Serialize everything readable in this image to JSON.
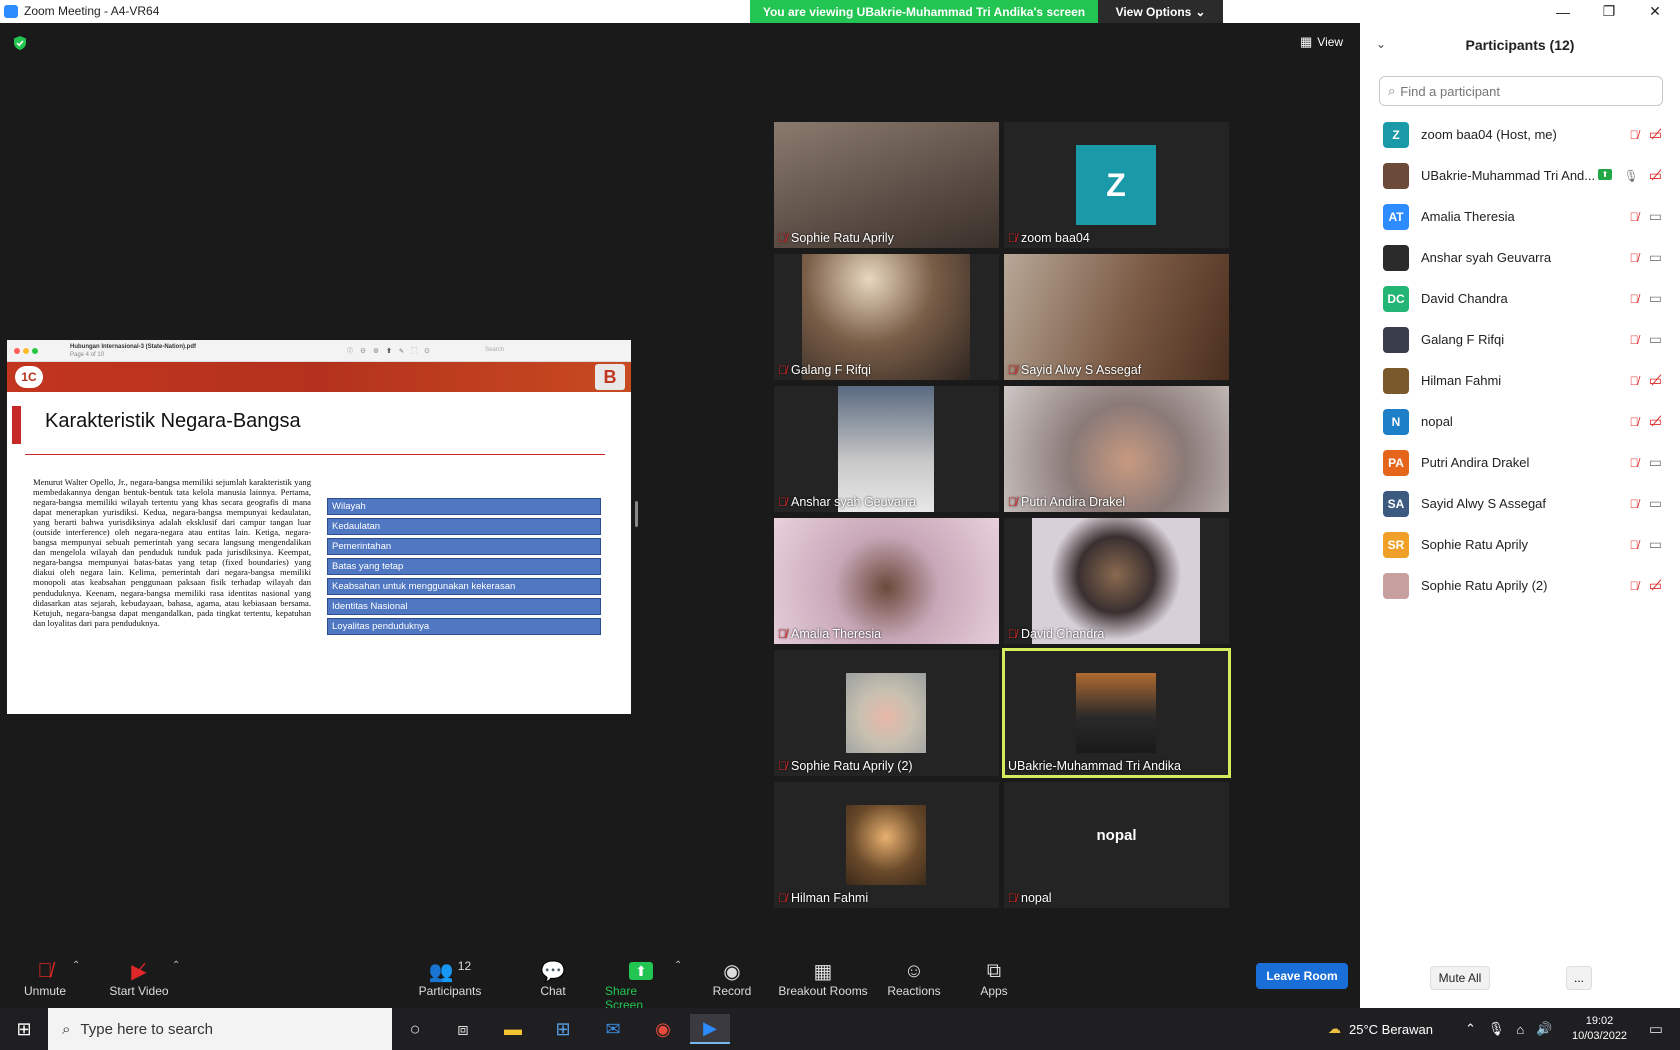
{
  "window": {
    "title": "Zoom Meeting - A4-VR64"
  },
  "banner": {
    "viewing_text": "You are viewing UBakrie-Muhammad Tri Andika's screen",
    "view_options": "View Options"
  },
  "view_button": {
    "label": "View"
  },
  "share": {
    "filename": "Hubungan Internasional-3 (State-Nation).pdf",
    "page_info": "Page 4 of 10",
    "search_placeholder": "Search",
    "slide_title": "Karakteristik Negara-Bangsa",
    "paragraph": "Menurut Walter Opello, Jr., negara-bangsa memiliki sejumlah karakteristik yang membedakannya dengan bentuk-bentuk tata kelola manusia lainnya. Pertama, negara-bangsa memiliki wilayah tertentu yang khas secara geografis di mana dapat menerapkan yurisdiksi. Kedua, negara-bangsa mempunyai kedaulatan, yang berarti bahwa yurisdiksinya adalah eksklusif dari campur tangan luar (outside interference) oleh negara-negara atau entitas lain. Ketiga, negara-bangsa mempunyai sebuah pemerintah yang secara langsung mengendalikan dan mengelola wilayah dan penduduk tunduk pada jurisdiksinya. Keempat, negara-bangsa mempunyai batas-batas yang tetap (fixed boundaries) yang diakui oleh negara lain. Kelima, pemerintah dari negara-bangsa memiliki monopoli atas keabsahan penggunaan paksaan fisik terhadap wilayah dan penduduknya. Keenam, negara-bangsa memiliki rasa identitas nasional yang didasarkan atas sejarah, kebudayaan, bahasa, agama, atau kebiasaan bersama. Ketujuh, negara-bangsa dapat mengandalkan, pada tingkat tertentu, kepatuhan dan loyalitas dari para penduduknya.",
    "items": [
      "Wilayah",
      "Kedaulatan",
      "Pemerintahan",
      "Batas yang tetap",
      "Keabsahan untuk menggunakan kekerasan",
      "Identitas Nasional",
      "Loyalitas penduduknya"
    ]
  },
  "tiles": [
    {
      "name": "Sophie Ratu Aprily",
      "muted": true
    },
    {
      "name": "zoom baa04",
      "muted": true,
      "avatar_letter": "Z"
    },
    {
      "name": "Galang F Rifqi",
      "muted": true
    },
    {
      "name": "Sayid Alwy S Assegaf",
      "muted": true
    },
    {
      "name": "Anshar syah Geuvarra",
      "muted": true
    },
    {
      "name": "Putri Andira Drakel",
      "muted": true
    },
    {
      "name": "Amalia Theresia",
      "muted": true
    },
    {
      "name": "David Chandra",
      "muted": true
    },
    {
      "name": "Sophie Ratu Aprily (2)",
      "muted": true
    },
    {
      "name": "UBakrie-Muhammad Tri Andika",
      "muted": false,
      "active_speaker": true
    },
    {
      "name": "Hilman Fahmi",
      "muted": true
    },
    {
      "name": "nopal",
      "muted": true,
      "center_text": "nopal"
    }
  ],
  "toolbar": {
    "unmute": "Unmute",
    "start_video": "Start Video",
    "participants": "Participants",
    "participants_count": "12",
    "chat": "Chat",
    "share_screen": "Share Screen",
    "record": "Record",
    "breakout_rooms": "Breakout Rooms",
    "reactions": "Reactions",
    "apps": "Apps",
    "leave": "Leave Room"
  },
  "panel": {
    "title": "Participants (12)",
    "search_placeholder": "Find a participant",
    "mute_all": "Mute All",
    "more": "...",
    "participants": [
      {
        "initials": "Z",
        "name": "zoom baa04 (Host, me)",
        "color": "#1a9aa8",
        "video_off": true,
        "photo": false
      },
      {
        "initials": "",
        "name": "UBakrie-Muhammad Tri And...",
        "color": "#6b4a3a",
        "video_off": true,
        "photo": true,
        "sharing": true,
        "mic_on": true
      },
      {
        "initials": "AT",
        "name": "Amalia Theresia",
        "color": "#2d8cff",
        "video_off": false,
        "photo": false
      },
      {
        "initials": "",
        "name": "Anshar syah Geuvarra",
        "color": "#2b2b2b",
        "video_off": false,
        "photo": true
      },
      {
        "initials": "DC",
        "name": "David Chandra",
        "color": "#23b573",
        "video_off": false,
        "photo": false
      },
      {
        "initials": "",
        "name": "Galang F Rifqi",
        "color": "#3a3d4a",
        "video_off": false,
        "photo": true
      },
      {
        "initials": "",
        "name": "Hilman Fahmi",
        "color": "#7a5a2a",
        "video_off": true,
        "photo": true
      },
      {
        "initials": "N",
        "name": "nopal",
        "color": "#1e7fc9",
        "video_off": true,
        "photo": false
      },
      {
        "initials": "PA",
        "name": "Putri Andira Drakel",
        "color": "#e5661a",
        "video_off": false,
        "photo": false
      },
      {
        "initials": "SA",
        "name": "Sayid Alwy S Assegaf",
        "color": "#3d5a80",
        "video_off": false,
        "photo": false
      },
      {
        "initials": "SR",
        "name": "Sophie Ratu Aprily",
        "color": "#f0a028",
        "video_off": false,
        "photo": false
      },
      {
        "initials": "",
        "name": "Sophie Ratu Aprily (2)",
        "color": "#c9a0a0",
        "video_off": true,
        "photo": true
      }
    ]
  },
  "taskbar": {
    "search_placeholder": "Type here to search",
    "weather": "25°C  Berawan",
    "time": "19:02",
    "date": "10/03/2022"
  }
}
